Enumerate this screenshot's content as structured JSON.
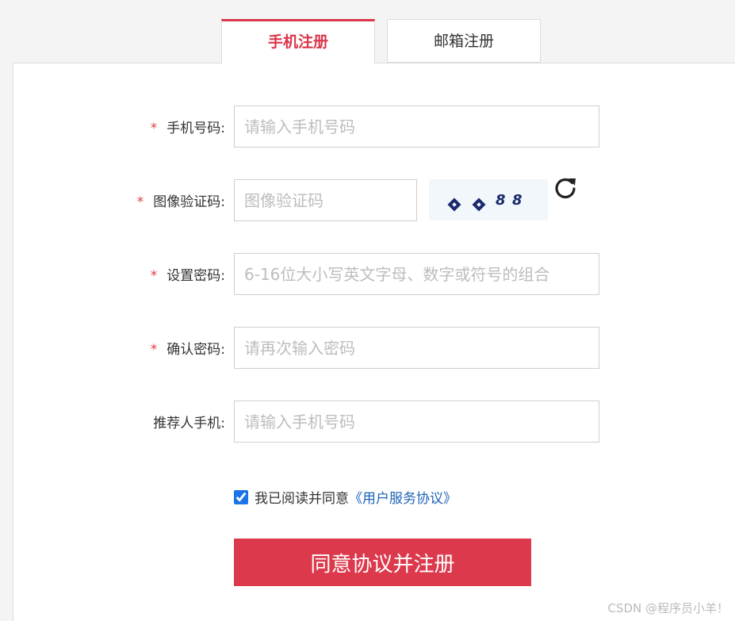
{
  "tabs": {
    "phone": "手机注册",
    "email": "邮箱注册"
  },
  "form": {
    "required_mark": "*",
    "phone": {
      "label": "手机号码:",
      "placeholder": "请输入手机号码"
    },
    "captcha": {
      "label": "图像验证码:",
      "placeholder": "图像验证码",
      "code": "4488"
    },
    "password": {
      "label": "设置密码:",
      "placeholder": "6-16位大小写英文字母、数字或符号的组合"
    },
    "confirm": {
      "label": "确认密码:",
      "placeholder": "请再次输入密码"
    },
    "referrer": {
      "label": "推荐人手机:",
      "placeholder": "请输入手机号码"
    }
  },
  "agreement": {
    "checked": true,
    "text": "我已阅读并同意",
    "link": "《用户服务协议》"
  },
  "submit_label": "同意协议并注册",
  "watermark": "CSDN @程序员小羊！",
  "colors": {
    "accent": "#d9364a",
    "link": "#1d62b6"
  }
}
